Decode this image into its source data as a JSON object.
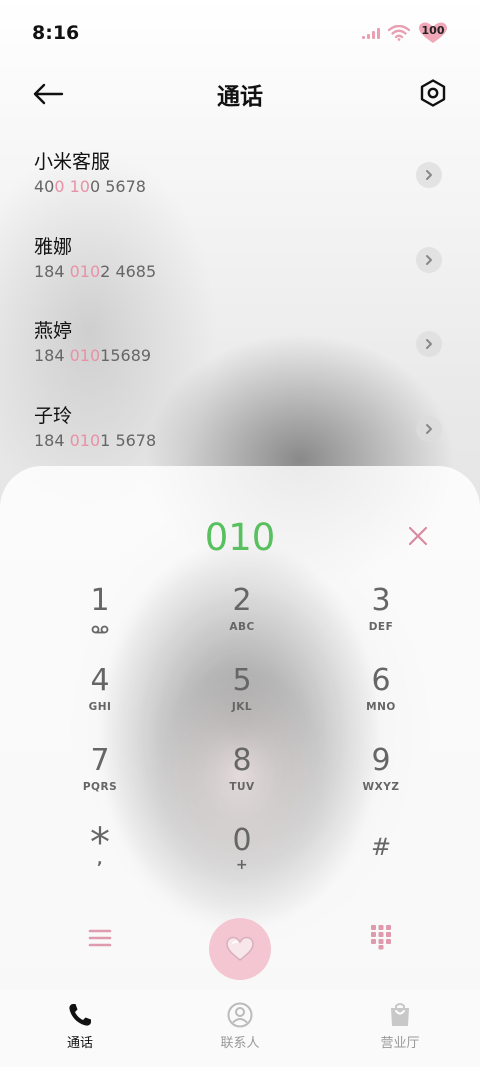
{
  "status_bar": {
    "time": "8:16",
    "battery_level": "100",
    "accent_color": "#e8a0b2"
  },
  "header": {
    "title": "通话",
    "back_icon": "arrow-left-icon",
    "settings_icon": "hexagon-settings-icon"
  },
  "results": [
    {
      "name": "小米客服",
      "number_parts": [
        "40",
        "0 10",
        "0 5678"
      ]
    },
    {
      "name": "雅娜",
      "number_parts": [
        "184 ",
        "010",
        "2 4685"
      ]
    },
    {
      "name": "燕婷",
      "number_parts": [
        "184 ",
        "010",
        "15689"
      ]
    },
    {
      "name": "子玲",
      "number_parts": [
        "184 ",
        "010",
        "1 5678"
      ]
    }
  ],
  "dialer": {
    "input": "010",
    "input_color": "#58c05e",
    "keys": [
      {
        "digit": "1",
        "sub": "voicemail-icon"
      },
      {
        "digit": "2",
        "sub": "ABC"
      },
      {
        "digit": "3",
        "sub": "DEF"
      },
      {
        "digit": "4",
        "sub": "GHI"
      },
      {
        "digit": "5",
        "sub": "JKL"
      },
      {
        "digit": "6",
        "sub": "MNO"
      },
      {
        "digit": "7",
        "sub": "PQRS"
      },
      {
        "digit": "8",
        "sub": "TUV"
      },
      {
        "digit": "9",
        "sub": "WXYZ"
      },
      {
        "digit": "*",
        "sub": ","
      },
      {
        "digit": "0",
        "sub": "+"
      },
      {
        "digit": "#",
        "sub": ""
      }
    ]
  },
  "bottom_nav": [
    {
      "label": "通话",
      "icon": "phone-icon",
      "active": true
    },
    {
      "label": "联系人",
      "icon": "contact-icon",
      "active": false
    },
    {
      "label": "营业厅",
      "icon": "shopping-bag-icon",
      "active": false
    }
  ]
}
